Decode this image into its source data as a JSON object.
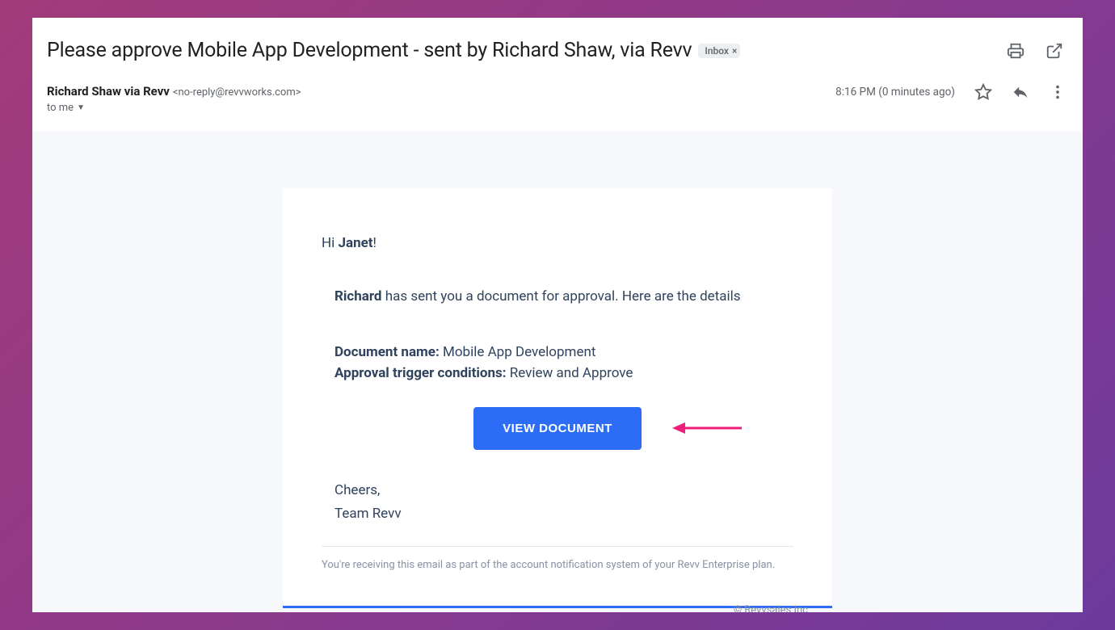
{
  "subject": {
    "text": "Please approve Mobile App Development - sent by Richard Shaw, via Revv",
    "chip_label": "Inbox"
  },
  "sender": {
    "name": "Richard Shaw via Revv",
    "email": "<no-reply@revvworks.com>",
    "to_label": "to me",
    "timestamp": "8:16 PM (0 minutes ago)"
  },
  "body": {
    "greet_prefix": "Hi ",
    "greet_name": "Janet",
    "greet_suffix": "!",
    "line1_name": "Richard",
    "line1_rest": " has sent you a document for approval. Here are the details",
    "docname_label": "Document name:",
    "docname_value": " Mobile App Development",
    "trigger_label": "Approval trigger conditions:",
    "trigger_value": " Review and Approve",
    "cta": "VIEW DOCUMENT",
    "sign1": "Cheers,",
    "sign2": "Team Revv",
    "disclaimer": "You're receiving this email as part of the account notification system of your Revv Enterprise plan.",
    "copyright": "© Revvsales Inc"
  }
}
